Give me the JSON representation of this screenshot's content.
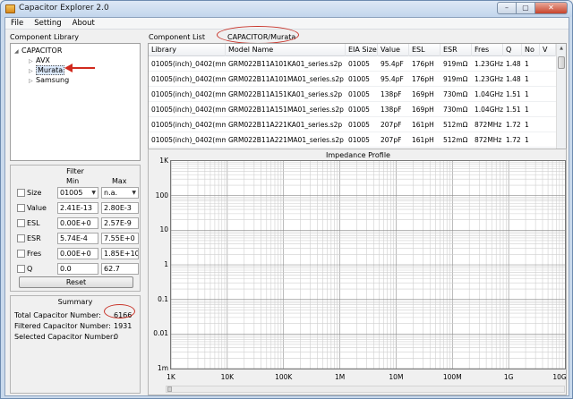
{
  "window": {
    "title": "Capacitor Explorer 2.0",
    "controls": {
      "minimize": "–",
      "maximize": "▢",
      "close": "✕"
    }
  },
  "menu": [
    "File",
    "Setting",
    "About"
  ],
  "library": {
    "label": "Component Library",
    "root": "CAPACITOR",
    "items": [
      "AVX",
      "Murata",
      "Samsung"
    ],
    "selected": "Murata"
  },
  "component_list": {
    "label": "Component List",
    "path": "CAPACITOR/Murata",
    "columns": [
      "Library",
      "Model Name",
      "EIA Size",
      "Value",
      "ESL",
      "ESR",
      "Fres",
      "Q",
      "No",
      "V"
    ],
    "rows": [
      [
        "01005(inch)_0402(mm)",
        "GRM022B11A101KA01_series.s2p",
        "01005",
        "95.4pF",
        "176pH",
        "919mΩ",
        "1.23GHz",
        "1.48",
        "1",
        ""
      ],
      [
        "01005(inch)_0402(mm)",
        "GRM022B11A101MA01_series.s2p",
        "01005",
        "95.4pF",
        "176pH",
        "919mΩ",
        "1.23GHz",
        "1.48",
        "1",
        ""
      ],
      [
        "01005(inch)_0402(mm)",
        "GRM022B11A151KA01_series.s2p",
        "01005",
        "138pF",
        "169pH",
        "730mΩ",
        "1.04GHz",
        "1.51",
        "1",
        ""
      ],
      [
        "01005(inch)_0402(mm)",
        "GRM022B11A151MA01_series.s2p",
        "01005",
        "138pF",
        "169pH",
        "730mΩ",
        "1.04GHz",
        "1.51",
        "1",
        ""
      ],
      [
        "01005(inch)_0402(mm)",
        "GRM022B11A221KA01_series.s2p",
        "01005",
        "207pF",
        "161pH",
        "512mΩ",
        "872MHz",
        "1.72",
        "1",
        ""
      ],
      [
        "01005(inch)_0402(mm)",
        "GRM022B11A221MA01_series.s2p",
        "01005",
        "207pF",
        "161pH",
        "512mΩ",
        "872MHz",
        "1.72",
        "1",
        ""
      ]
    ]
  },
  "filter": {
    "label": "Filter",
    "min_label": "Min",
    "max_label": "Max",
    "rows": [
      {
        "name": "Size",
        "min": "01005",
        "max": "n.a.",
        "checked": false
      },
      {
        "name": "Value",
        "min": "2.41E-13",
        "max": "2.80E-3",
        "checked": false
      },
      {
        "name": "ESL",
        "min": "0.00E+0",
        "max": "2.57E-9",
        "checked": false
      },
      {
        "name": "ESR",
        "min": "5.74E-4",
        "max": "7.55E+0",
        "checked": false
      },
      {
        "name": "Fres",
        "min": "0.00E+0",
        "max": "1.85E+10",
        "checked": false
      },
      {
        "name": "Q",
        "min": "0.0",
        "max": "62.7",
        "checked": false
      }
    ],
    "reset_label": "Reset"
  },
  "summary": {
    "label": "Summary",
    "total_label": "Total Capacitor Number:",
    "total": "6166",
    "filtered_label": "Filtered Capacitor Number:",
    "filtered": "1931",
    "selected_label": "Selected Capacitor Number:",
    "selected": "0"
  },
  "chart_data": {
    "type": "line",
    "title": "Impedance Profile",
    "xlabel": "",
    "ylabel": "",
    "x_scale": "log",
    "y_scale": "log",
    "xlim": [
      1000,
      10000000000
    ],
    "ylim": [
      0.001,
      1000
    ],
    "x_tick_labels": [
      "1K",
      "10K",
      "100K",
      "1M",
      "10M",
      "100M",
      "1G",
      "10G"
    ],
    "y_tick_labels": [
      "1K",
      "100",
      "10",
      "1",
      "0.1",
      "0.01",
      "1m"
    ],
    "grid": true,
    "series": []
  }
}
